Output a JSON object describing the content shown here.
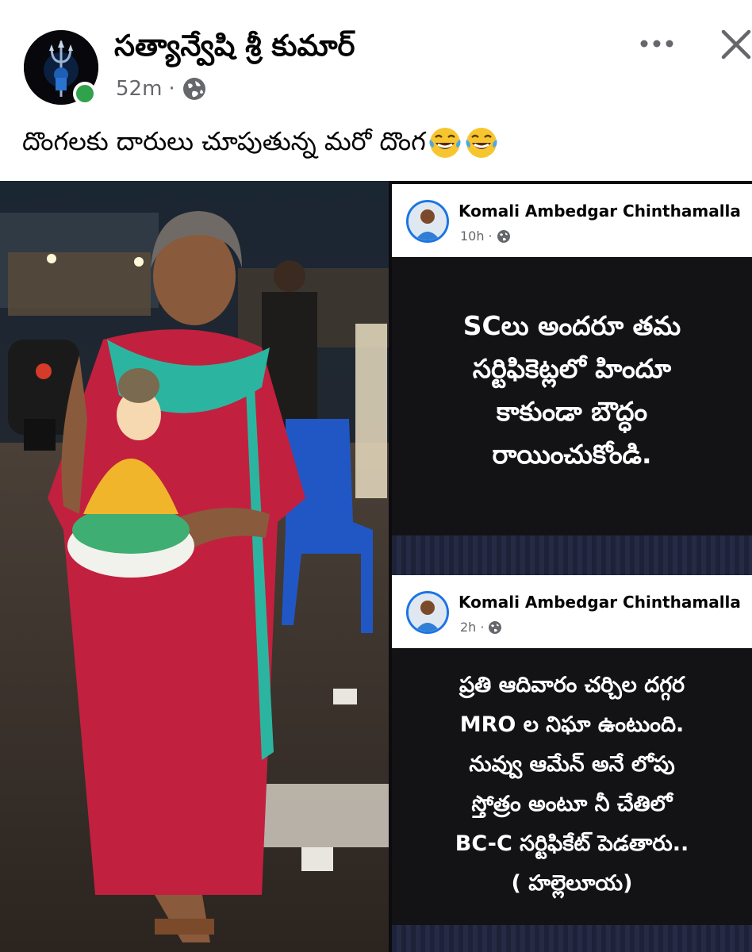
{
  "post": {
    "author": "సత్యాన్వేషి శ్రీ కుమార్",
    "time": "52m",
    "separator": "·",
    "caption": "దొంగలకు దారులు చూపుతున్న మరో దొంగ",
    "caption_emoji": [
      "face-with-tears-of-joy",
      "face-with-tears-of-joy"
    ]
  },
  "shared": {
    "posts": [
      {
        "author": "Komali Ambedgar Chinthamalla",
        "time": "10h",
        "separator": "·",
        "lines": [
          "SCలు అందరూ తమ",
          "సర్టిఫికెట్లలో హిందూ",
          "కాకుండా బౌద్ధం",
          "రాయించుకోండి."
        ]
      },
      {
        "author": "Komali Ambedgar Chinthamalla",
        "time": "2h",
        "separator": "·",
        "lines": [
          "ప్రతి ఆదివారం చర్చిల దగ్గర",
          "MRO ల నిఘా ఉంటుంది.",
          "నువ్వు ఆమేన్ అనే లోపు",
          "స్తోత్రం అంటూ నీ చేతిలో",
          "BC-C సర్టిఫికేట్ పెడతారు..",
          "( హల్లెలూయ)"
        ]
      }
    ]
  },
  "icons": {
    "avatar": "trishul-avatar-icon",
    "globe": "globe-icon",
    "more": "more-options-icon",
    "close": "close-icon"
  },
  "colors": {
    "online": "#31a24c",
    "meta_text": "#65676b",
    "panel_bg": "#131316"
  }
}
